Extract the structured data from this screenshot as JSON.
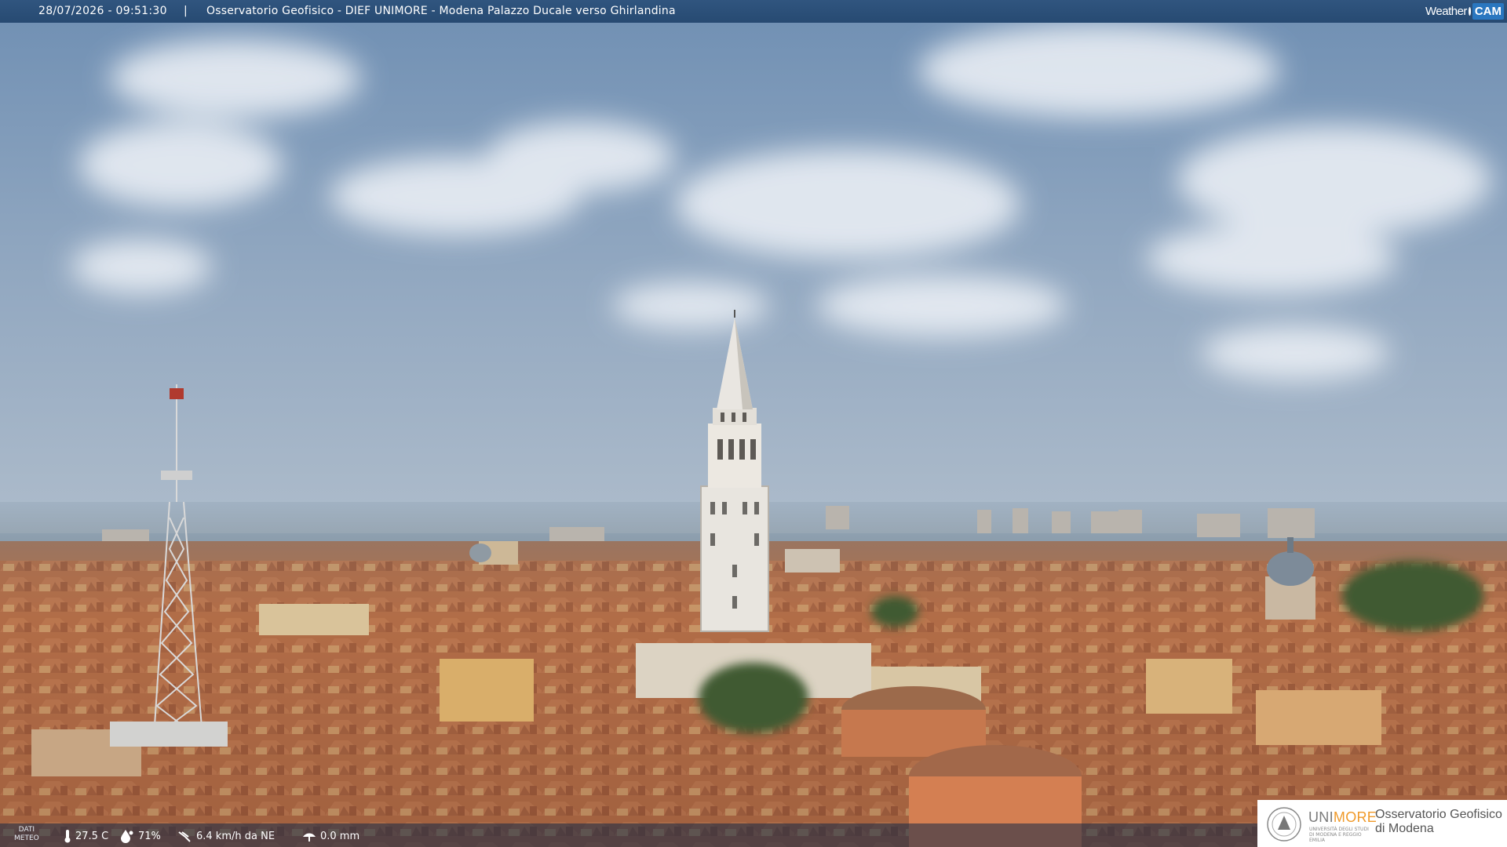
{
  "banner": {
    "timestamp": "28/07/2026 - 09:51:30",
    "separator": "|",
    "caption": "Osservatorio Geofisico - DIEF UNIMORE - Modena Palazzo Ducale verso Ghirlandina",
    "brand_weather": "Weather",
    "brand_cam": "CAM"
  },
  "weather": {
    "label_line1": "DATI",
    "label_line2": "METEO",
    "temperature": "27.5 C",
    "humidity": "71%",
    "wind": "6.4 km/h da NE",
    "rain": "0.0 mm"
  },
  "logo": {
    "uni_part1": "UNI",
    "uni_part2": "MORE",
    "uni_sub": "UNIVERSITÀ DEGLI STUDI DI MODENA E REGGIO EMILIA",
    "observatory_line1": "Osservatorio Geofisico",
    "observatory_line2": "di Modena"
  },
  "colors": {
    "sky_top": "#6f8fb3",
    "sky_horizon": "#a9b8c9",
    "roof": "#b9714a",
    "banner": "#2c5079",
    "uni_accent": "#f09a2a"
  },
  "icons": [
    "thermometer-icon",
    "humidity-drop-icon",
    "wind-icon",
    "rain-icon",
    "weathercam-logo-icon",
    "university-seal-icon"
  ]
}
